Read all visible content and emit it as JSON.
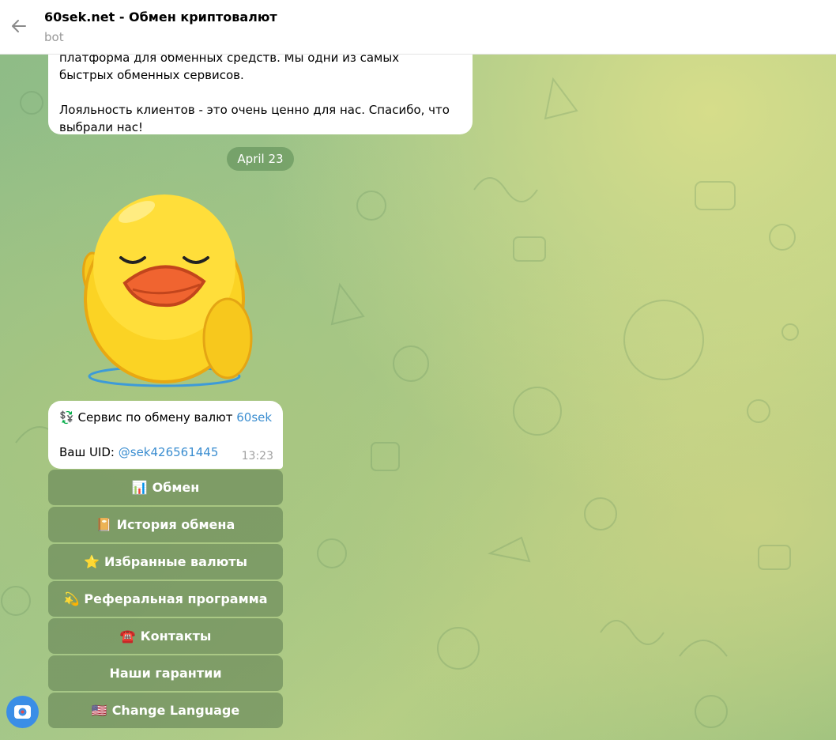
{
  "header": {
    "title": "60sek.net - Обмен криптовалют",
    "subtitle": "bot"
  },
  "previous_message": {
    "line_partial": "платформа для обменных средств. Мы одни из самых",
    "line2": "быстрых обменных сервисов.",
    "line3": "Лояльность клиентов - это очень ценно для нас. Спасибо, что",
    "line4": "выбрали нас!"
  },
  "date_separator": "April 23",
  "message": {
    "icon": "💱",
    "service_text": "Сервис по обмену валют ",
    "service_link": "60sek",
    "uid_label": "Ваш UID: ",
    "uid_value": "@sek426561445",
    "time": "13:23"
  },
  "keyboard": [
    {
      "icon": "📊",
      "label": "Обмен"
    },
    {
      "icon": "📔",
      "label": "История обмена"
    },
    {
      "icon": "⭐",
      "label": "Избранные валюты"
    },
    {
      "icon": "💫",
      "label": "Реферальная программа"
    },
    {
      "icon": "☎️",
      "label": "Контакты"
    },
    {
      "icon": "",
      "label": "Наши гарантии"
    },
    {
      "icon": "🇺🇸",
      "label": "Change Language"
    }
  ],
  "icons": {
    "back": "arrow-left-icon",
    "sticker": "duck-sticker",
    "bot_menu": "bot-menu-icon"
  },
  "colors": {
    "link": "#3a8dd0",
    "button_bg": "#648256",
    "header_bg": "#ffffff"
  }
}
